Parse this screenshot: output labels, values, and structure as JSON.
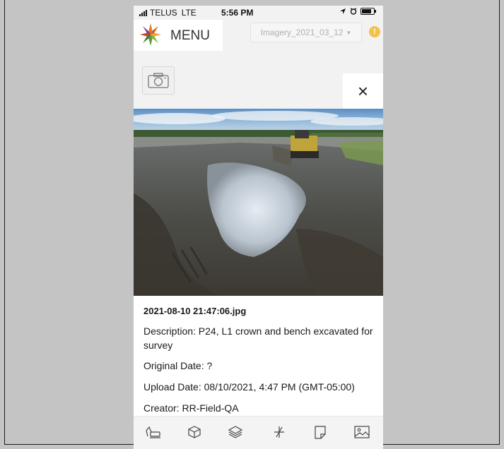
{
  "status_bar": {
    "carrier": "TELUS",
    "network": "LTE",
    "time": "5:56 PM"
  },
  "header": {
    "menu_label": "MENU",
    "imagery_selected": "Imagery_2021_03_12",
    "warning_glyph": "!"
  },
  "photo_viewer": {
    "close_glyph": "×",
    "filename": "2021-08-10 21:47:06.jpg",
    "description": "Description: P24, L1 crown and bench excavated for survey",
    "original_date": "Original Date: ?",
    "upload_date": "Upload Date: 08/10/2021, 4:47 PM (GMT-05:00)",
    "creator": "Creator: RR-Field-QA"
  },
  "toolbar": {
    "items": [
      "excavator-icon",
      "cube-icon",
      "layers-icon",
      "survey-point-icon",
      "note-icon",
      "image-icon"
    ]
  },
  "colors": {
    "accent_warning": "#f2c14e",
    "logo_orange": "#e8792b",
    "logo_green": "#5a9a3a",
    "logo_purple": "#7a3e8e"
  }
}
